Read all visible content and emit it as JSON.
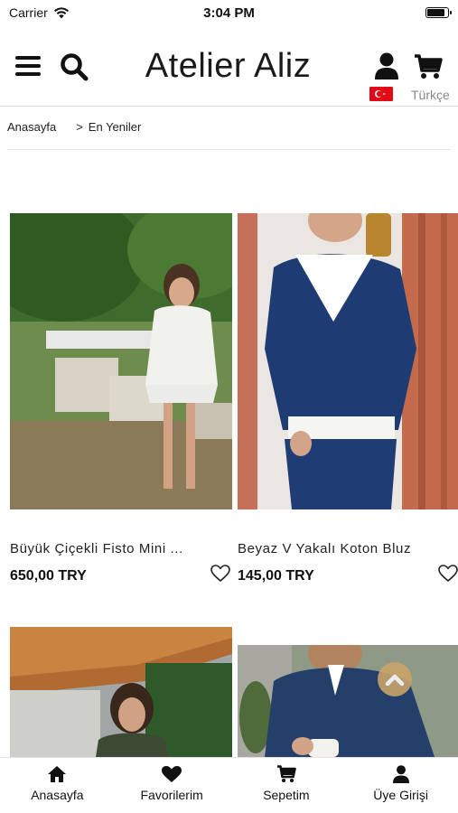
{
  "status_bar": {
    "carrier": "Carrier",
    "time": "3:04 PM",
    "battery_level": 0.9
  },
  "header": {
    "brand": "Atelier Aliz",
    "language": "Türkçe",
    "flag_color": "#e30a17"
  },
  "breadcrumb": {
    "home": "Anasayfa",
    "separator": ">",
    "current": "En Yeniler"
  },
  "products": [
    {
      "name": "Büyük Çiçekli Fisto Mini ...",
      "price": "650,00 TRY"
    },
    {
      "name": "Beyaz V Yakalı Koton Bluz",
      "price": "145,00 TRY"
    },
    {
      "name": "",
      "price": ""
    },
    {
      "name": "",
      "price": ""
    }
  ],
  "tabbar": {
    "items": [
      {
        "label": "Anasayfa",
        "icon": "home-icon"
      },
      {
        "label": "Favorilerim",
        "icon": "heart-icon"
      },
      {
        "label": "Sepetim",
        "icon": "cart-icon"
      },
      {
        "label": "Üye Girişi",
        "icon": "user-icon"
      }
    ]
  },
  "colors": {
    "accent": "#c9a36a",
    "text": "#111111",
    "divider": "#dddddd"
  }
}
